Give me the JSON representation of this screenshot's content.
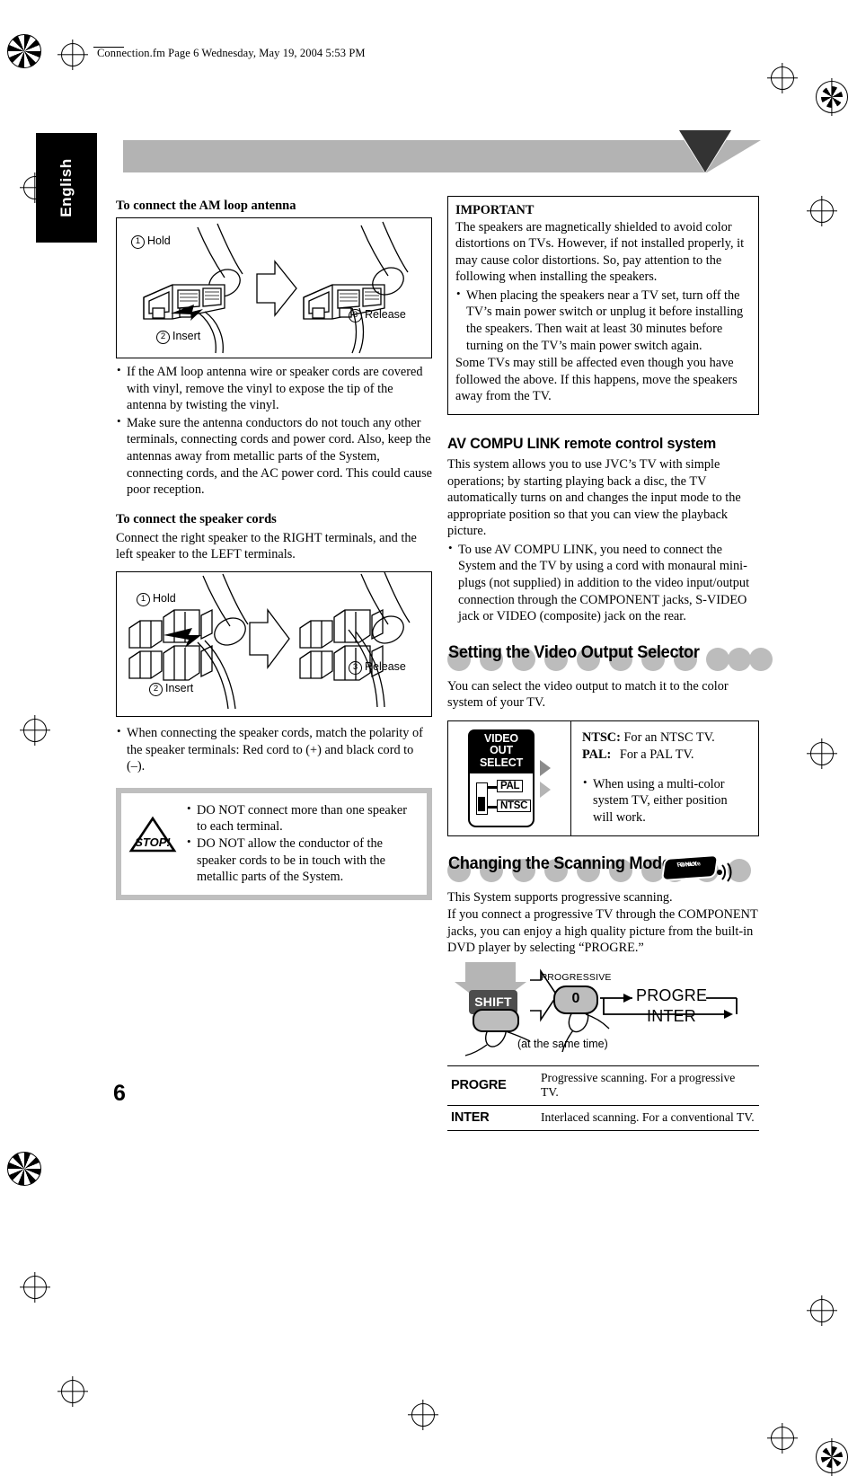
{
  "header": {
    "file_line": "Connection.fm  Page 6  Wednesday, May 19, 2004  5:53 PM"
  },
  "side_tab": {
    "language": "English"
  },
  "page_number": "6",
  "left_column": {
    "antenna_heading": "To connect the AM loop antenna",
    "antenna_figure": {
      "step1": "Hold",
      "step1_num": "1",
      "step2": "Insert",
      "step2_num": "2",
      "step3": "Release",
      "step3_num": "3"
    },
    "antenna_bullets": [
      "If the AM loop antenna wire or speaker cords are covered with vinyl, remove the vinyl to expose the tip of the antenna by twisting the vinyl.",
      "Make sure the antenna conductors do not touch any other terminals, connecting cords and power cord. Also, keep the antennas away from metallic parts of the System, connecting cords, and the AC power cord. This could cause poor reception."
    ],
    "speaker_heading": "To connect the speaker cords",
    "speaker_intro": "Connect the right speaker to the RIGHT terminals, and the left speaker to the LEFT terminals.",
    "speaker_figure": {
      "step1": "Hold",
      "step1_num": "1",
      "step2": "Insert",
      "step2_num": "2",
      "step3": "Release",
      "step3_num": "3"
    },
    "polarity_bullet": "When connecting the speaker cords, match the polarity of the speaker terminals: Red cord to (+) and black cord to (–).",
    "caution": {
      "icon_text": "STOP!",
      "items": [
        "DO NOT connect more than one speaker to each terminal.",
        "DO NOT allow the conductor of the speaker cords to be in touch with the metallic parts of the System."
      ]
    }
  },
  "right_column": {
    "important": {
      "title": "IMPORTANT",
      "paragraph1": "The speakers are magnetically shielded to avoid color distortions on TVs. However, if not installed properly, it may cause color distortions. So, pay attention to the following when installing the speakers.",
      "bullet": "When placing the speakers near a TV set, turn off the TV’s main power switch or unplug it before installing the speakers. Then wait at least 30 minutes before turning on the TV’s main power switch again.",
      "paragraph2": "Some TVs may still be affected even though you have followed the above. If this happens, move the speakers away from the TV."
    },
    "avcompu": {
      "heading": "AV COMPU LINK remote control system",
      "paragraph": "This system allows you to use JVC’s TV with simple operations; by starting playing back a disc, the TV automatically turns on and changes the input mode to the appropriate position so that you can view the playback picture.",
      "bullet": "To use AV COMPU LINK, you need to connect the System and the TV by using a cord with monaural mini-plugs (not supplied) in addition to the video input/output connection through the COMPONENT jacks, S-VIDEO jack or VIDEO (composite) jack on the rear."
    },
    "video_output": {
      "heading": "Setting the Video Output Selector",
      "paragraph": "You can select the video output to match it to the color system of your TV.",
      "selector_label_line1": "VIDEO",
      "selector_label_line2": "OUT",
      "selector_label_line3": "SELECT",
      "option_pal": "PAL",
      "option_ntsc": "NTSC",
      "ntsc_term": "NTSC:",
      "ntsc_desc": "For an NTSC TV.",
      "pal_term": "PAL:",
      "pal_desc": "For a PAL TV.",
      "note": "When using a multi-color system TV, either position will work."
    },
    "scanning": {
      "heading": "Changing the Scanning Mode",
      "badge_line1": "Remote",
      "badge_line2": "ONLY",
      "paragraph": "This System supports progressive scanning.\nIf you connect a progressive TV through the COMPONENT jacks, you can enjoy a high quality picture from the built-in DVD player by selecting “PROGRE.”",
      "figure": {
        "shift_key": "SHIFT",
        "progressive_label": "PROGRESSIVE",
        "button_digit": "0",
        "same_time": "(at the same time)",
        "cycle_first": "PROGRE",
        "cycle_second": "INTER"
      },
      "table": [
        {
          "mode": "PROGRE",
          "desc": "Progressive scanning. For a progressive TV."
        },
        {
          "mode": "INTER",
          "desc": "Interlaced scanning. For a conventional TV."
        }
      ]
    }
  }
}
